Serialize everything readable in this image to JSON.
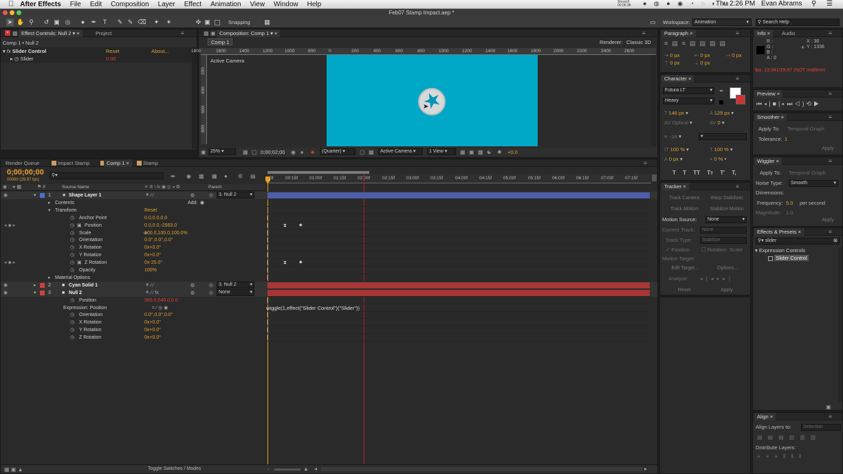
{
  "menubar": {
    "apple_icon": "apple-icon",
    "app_name": "After Effects",
    "items": [
      "File",
      "Edit",
      "Composition",
      "Layer",
      "Effect",
      "Animation",
      "View",
      "Window",
      "Help"
    ],
    "showui": "ShowUI",
    "showui_time": "00:06:38",
    "clock": "Thu 2:26 PM",
    "user": "Evan Abrams"
  },
  "window": {
    "title": "Feb07 Stamp Impact.aep *"
  },
  "toolbar": {
    "snapping_label": "Snapping",
    "workspace_label": "Workspace:",
    "workspace_value": "Animation",
    "search_placeholder": "Search Help"
  },
  "effect_controls": {
    "tab_label": "Effect Controls: Null 2",
    "project_tab": "Project",
    "breadcrumb": "Comp 1 • Null 2",
    "effect_name": "Slider Control",
    "reset": "Reset",
    "about": "About...",
    "slider_label": "Slider",
    "slider_value": "0.00"
  },
  "composition": {
    "tab_label": "Composition: Comp 1",
    "flowchart_tab": "Comp 1",
    "renderer_label": "Renderer:",
    "renderer_value": "Classic 3D",
    "camera_label": "Active Camera",
    "ruler_labels": [
      "1800",
      "1600",
      "1400",
      "1200",
      "1000",
      "800",
      "600",
      "400",
      "200",
      "0",
      "200",
      "400",
      "600",
      "800",
      "1000",
      "1200",
      "1400",
      "1600",
      "1800",
      "2000",
      "2200",
      "2400",
      "2600",
      "2800"
    ],
    "vruler_labels": [
      "200",
      "400",
      "600",
      "800"
    ],
    "zoom": "25%",
    "timecode": "0;00;02;00",
    "resolution": "(Quarter)",
    "view_camera": "Active Camera",
    "views": "1 View",
    "exposure": "+0.0",
    "comp_color": "#00a8c8"
  },
  "timeline": {
    "tabs": [
      "Render Queue",
      "Impact Stamp",
      "Comp 1",
      "Stamp"
    ],
    "tab_colors": [
      "#888888",
      "#c8a060",
      "#c8a060",
      "#c8a060"
    ],
    "timecode": "0;00;00;00",
    "fps_info": "00000 (29.97 fps)",
    "search_placeholder": "",
    "col_source": "Source Name",
    "col_parent": "Parent",
    "time_labels": [
      "0f",
      "00:15f",
      "01:00f",
      "01:15f",
      "02:00f",
      "02:15f",
      "03:00f",
      "03:15f",
      "04:00f",
      "04:15f",
      "05:00f",
      "05:15f",
      "06:00f",
      "06:15f",
      "07:00f",
      "07:15f"
    ],
    "toggle_label": "Toggle Switches / Modes",
    "expression_text": "wiggle(1,effect(\"Slider Control\")(\"Slider\"))",
    "rows": [
      {
        "num": "1",
        "name": "Shape Layer 1",
        "label_color": "#4a6fd0",
        "parent": "3. Null 2",
        "kind": "layer"
      },
      {
        "name": "Contents",
        "value": "Add:",
        "kind": "group"
      },
      {
        "name": "Transform",
        "value": "Reset",
        "kind": "group"
      },
      {
        "name": "Anchor Point",
        "value": "0.0,0.0,0.0",
        "kind": "prop"
      },
      {
        "name": "Position",
        "value": "0.0,0.0,-2563.0",
        "kind": "prop-key"
      },
      {
        "name": "Scale",
        "value": "100.0,100.0,100.0%",
        "kind": "prop"
      },
      {
        "name": "Orientation",
        "value": "0.0°,0.0°,0.0°",
        "kind": "prop"
      },
      {
        "name": "X Rotation",
        "value": "0x+0.0°",
        "kind": "prop"
      },
      {
        "name": "Y Rotation",
        "value": "0x+0.0°",
        "kind": "prop"
      },
      {
        "name": "Z Rotation",
        "value": "0x-25.0°",
        "kind": "prop-key"
      },
      {
        "name": "Opacity",
        "value": "100%",
        "kind": "prop"
      },
      {
        "name": "Material Options",
        "value": "",
        "kind": "group"
      },
      {
        "num": "2",
        "name": "Cyan Solid 1",
        "label_color": "#d04040",
        "parent": "3. Null 2",
        "kind": "layer"
      },
      {
        "num": "3",
        "name": "Null 2",
        "label_color": "#d04040",
        "parent": "None",
        "kind": "layer"
      },
      {
        "name": "Position",
        "value": "960.0,540.0,0.0",
        "kind": "prop-red"
      },
      {
        "name": "Expression: Position",
        "value": "",
        "kind": "expr"
      },
      {
        "name": "Orientation",
        "value": "0.0°,0.0°,0.0°",
        "kind": "prop"
      },
      {
        "name": "X Rotation",
        "value": "0x+0.0°",
        "kind": "prop"
      },
      {
        "name": "Y Rotation",
        "value": "0x+0.0°",
        "kind": "prop"
      },
      {
        "name": "Z Rotation",
        "value": "0x+0.0°",
        "kind": "prop"
      }
    ]
  },
  "paragraph": {
    "tab": "Paragraph",
    "vals": [
      "0 px",
      "0 px",
      "0 px",
      "0 px",
      "0 px"
    ]
  },
  "character": {
    "tab": "Character",
    "font": "Futura LT",
    "style": "Heavy",
    "size": "146 px",
    "leading": "129 px",
    "kerning": "Optical",
    "tracking": "0",
    "stroke": "- px",
    "vscale": "100 %",
    "hscale": "100 %",
    "baseline": "0 px",
    "tsume": "0 %",
    "format_buttons": [
      "T",
      "T",
      "TT",
      "Tт",
      "T'",
      "T,"
    ]
  },
  "tracker": {
    "tab": "Tracker",
    "track_camera": "Track Camera",
    "warp": "Warp Stabilizer",
    "track_motion": "Track Motion",
    "stabilize": "Stabilize Motion",
    "motion_source_label": "Motion Source:",
    "motion_source": "None",
    "current_track_label": "Current Track:",
    "current_track": "None",
    "track_type_label": "Track Type:",
    "track_type": "Stabilize",
    "checks": [
      "Position",
      "Rotation",
      "Scale"
    ],
    "motion_target_label": "Motion Target:",
    "edit_target": "Edit Target...",
    "options": "Options...",
    "analyze_label": "Analyze:",
    "reset": "Reset",
    "apply": "Apply"
  },
  "info": {
    "tab": "Info",
    "audio_tab": "Audio",
    "r": "R :",
    "g": "G :",
    "b": "B :",
    "a": "A : 0",
    "x": "X : 36",
    "y": "Y : 1336",
    "fps": "fps: 13.941/29.97 (NOT realtime)"
  },
  "preview": {
    "tab": "Preview"
  },
  "smoother": {
    "tab": "Smoother",
    "apply_to_label": "Apply To:",
    "apply_to": "Temporal Graph",
    "tolerance_label": "Tolerance:",
    "tolerance": "1",
    "apply": "Apply"
  },
  "wiggler": {
    "tab": "Wiggler",
    "apply_to_label": "Apply To:",
    "apply_to": "Temporal Graph",
    "noise_label": "Noise Type:",
    "noise": "Smooth",
    "dims_label": "Dimensions:",
    "freq_label": "Frequency:",
    "freq": "5.0",
    "freq_unit": "per second",
    "mag_label": "Magnitude:",
    "mag": "1.0",
    "apply": "Apply"
  },
  "effects_presets": {
    "tab": "Effects & Presets",
    "search": "slider",
    "group": "Expression Controls",
    "item": "Slider Control"
  },
  "align": {
    "tab": "Align",
    "align_to_label": "Align Layers to:",
    "align_to": "Selection",
    "distribute_label": "Distribute Layers:"
  }
}
